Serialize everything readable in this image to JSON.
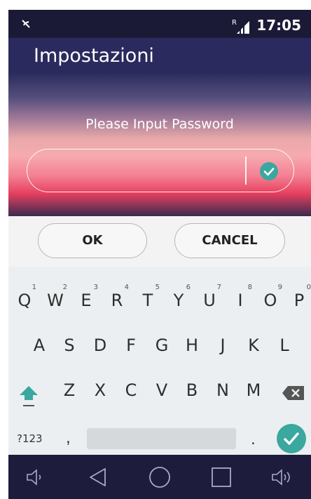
{
  "status_bar": {
    "time": "17:05",
    "network_badge": "R",
    "icons": [
      "mute-icon",
      "signal-icon"
    ]
  },
  "app_bar": {
    "title": "Impostazioni"
  },
  "dialog": {
    "prompt": "Please Input Password",
    "password_value": "",
    "confirm_icon": "check-circle-icon"
  },
  "buttons": {
    "ok_label": "OK",
    "cancel_label": "CANCEL"
  },
  "keyboard": {
    "row1": [
      {
        "key": "Q",
        "hint": "1"
      },
      {
        "key": "W",
        "hint": "2"
      },
      {
        "key": "E",
        "hint": "3"
      },
      {
        "key": "R",
        "hint": "4"
      },
      {
        "key": "T",
        "hint": "5"
      },
      {
        "key": "Y",
        "hint": "6"
      },
      {
        "key": "U",
        "hint": "7"
      },
      {
        "key": "I",
        "hint": "8"
      },
      {
        "key": "O",
        "hint": "9"
      },
      {
        "key": "P",
        "hint": "0"
      }
    ],
    "row2": [
      "A",
      "S",
      "D",
      "F",
      "G",
      "H",
      "J",
      "K",
      "L"
    ],
    "row3": [
      "Z",
      "X",
      "C",
      "V",
      "B",
      "N",
      "M"
    ],
    "symbols_key": "?123",
    "comma_key": ",",
    "period_key": ".",
    "colors": {
      "accent": "#3aa89e"
    }
  },
  "nav_bar": {
    "icons": [
      "volume-down-icon",
      "back-icon",
      "home-icon",
      "recents-icon",
      "volume-up-icon"
    ]
  }
}
